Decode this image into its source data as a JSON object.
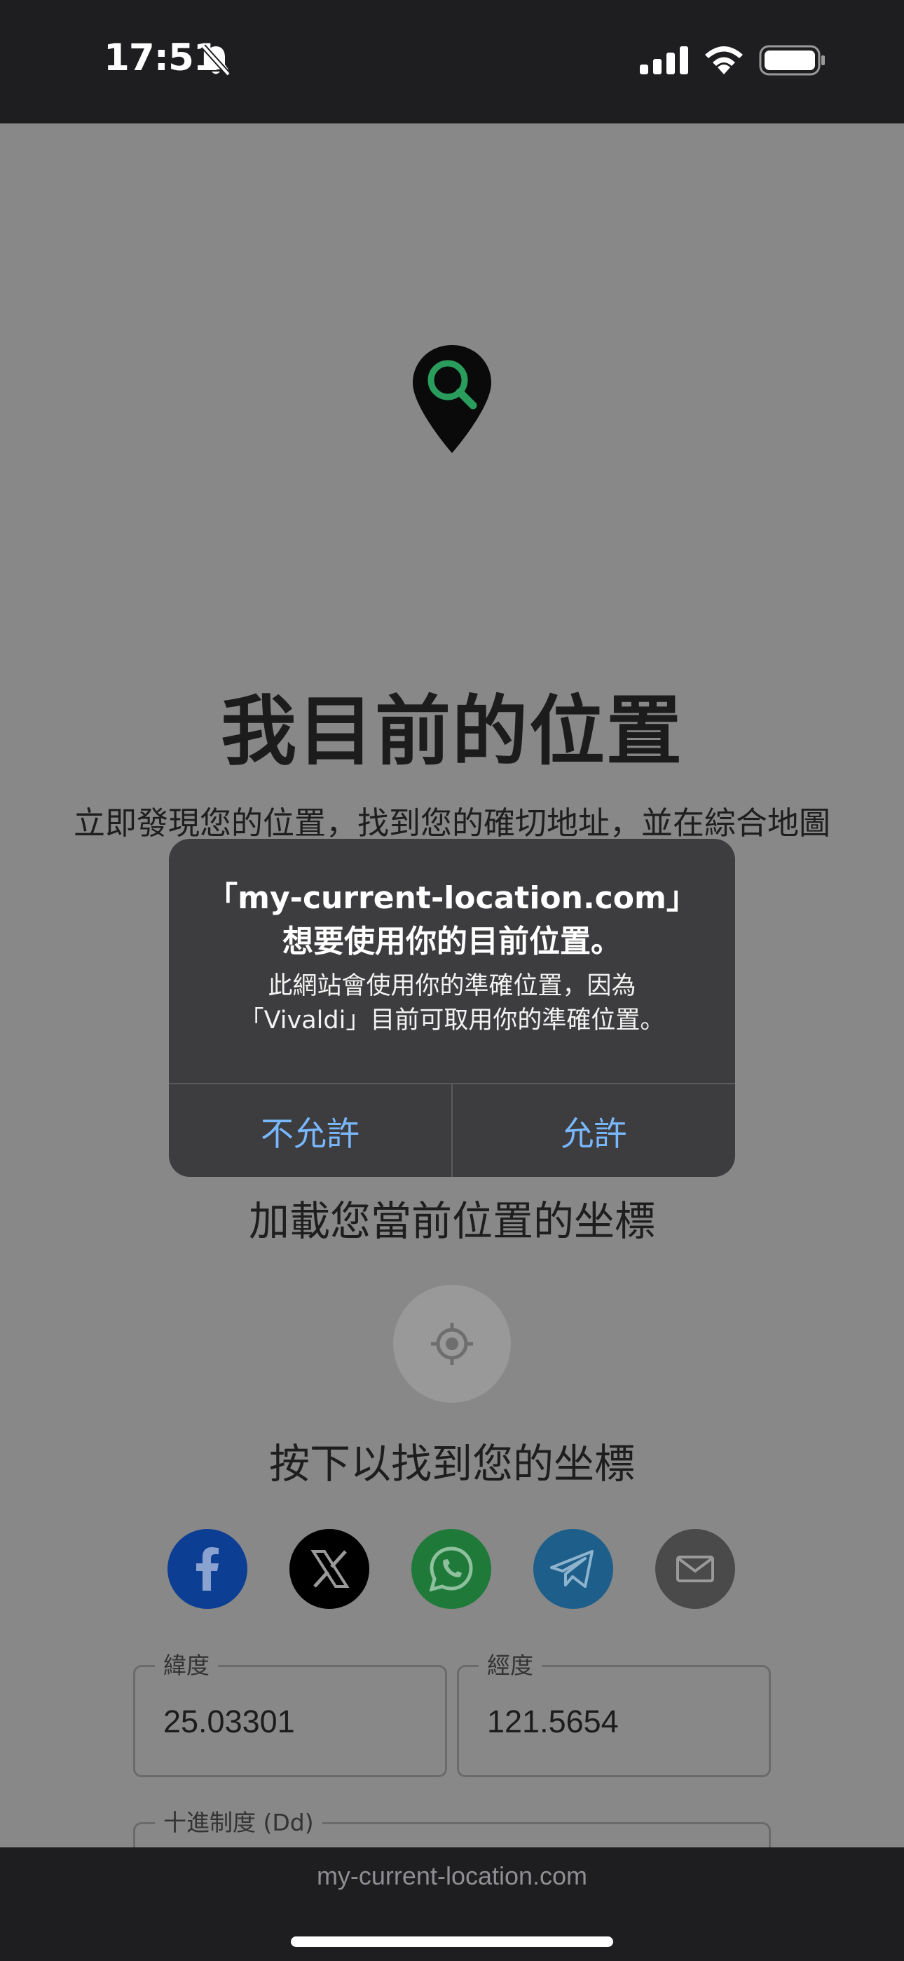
{
  "status_bar": {
    "time": "17:51"
  },
  "page": {
    "title": "我目前的位置",
    "subtitle": "立即發現您的位置，找到您的確切地址，並在綜合地圖",
    "coords_heading": "加載您當前位置的坐標",
    "locate_hint": "按下以找到您的坐標",
    "share_buttons": [
      {
        "name": "facebook",
        "icon": "facebook-icon",
        "color": "#0c3e93"
      },
      {
        "name": "x",
        "icon": "x-logo-icon",
        "color": "#000000"
      },
      {
        "name": "whatsapp",
        "icon": "whatsapp-icon",
        "color": "#1f7a3a"
      },
      {
        "name": "telegram",
        "icon": "telegram-icon",
        "color": "#1d5f8a"
      },
      {
        "name": "email",
        "icon": "mail-icon",
        "color": "#4a4a4a"
      }
    ],
    "fields": {
      "latitude": {
        "label": "緯度",
        "value": "25.03301"
      },
      "longitude": {
        "label": "經度",
        "value": "121.5654"
      },
      "decimal": {
        "label": "十進制度 (Dd)"
      }
    }
  },
  "dialog": {
    "title_line1": "「my-current-location.com」",
    "title_line2": "想要使用你的目前位置。",
    "message_line1": "此網站會使用你的準確位置，因為",
    "message_line2": "「Vivaldi」目前可取用你的準確位置。",
    "deny_label": "不允許",
    "allow_label": "允許",
    "button_color": "#79b8ff"
  },
  "browser": {
    "url": "my-current-location.com"
  }
}
